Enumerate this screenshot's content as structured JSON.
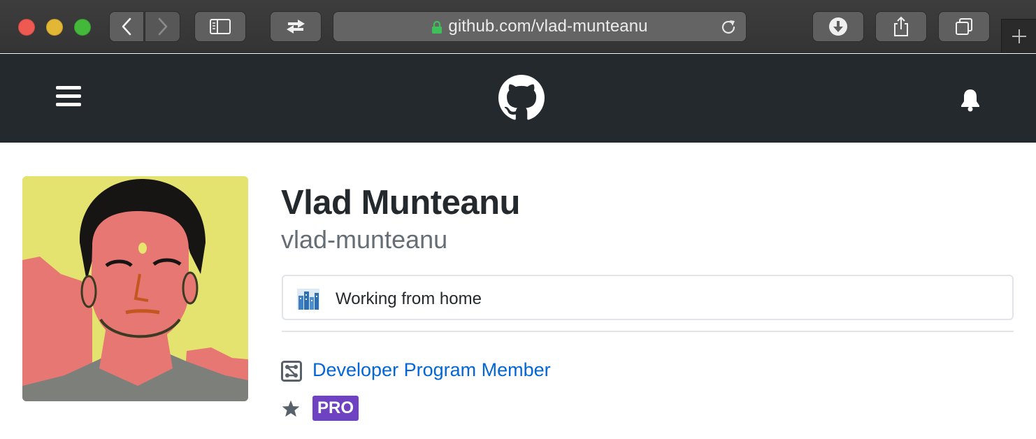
{
  "browser": {
    "url": "github.com/vlad-munteanu",
    "icons": {
      "back": "chevron-left-icon",
      "forward": "chevron-right-icon",
      "sidebar": "sidebar-icon",
      "switch": "tab-switch-arrows-icon",
      "lock": "lock-icon",
      "reload": "reload-icon",
      "download": "download-icon",
      "share": "share-icon",
      "tabs": "tab-overview-icon",
      "new_tab": "plus-icon"
    }
  },
  "header": {
    "icons": {
      "menu": "hamburger-menu-icon",
      "logo": "github-octocat-icon",
      "notifications": "bell-icon"
    }
  },
  "profile": {
    "name": "Vlad Munteanu",
    "login": "vlad-munteanu",
    "status": {
      "emoji": "cityscape-icon",
      "text": "Working from home"
    },
    "badges": {
      "developer_program": "Developer Program Member",
      "pro": "PRO"
    }
  },
  "colors": {
    "header_bg": "#24292e",
    "link": "#0366d6",
    "pro_badge": "#6f42c1"
  }
}
